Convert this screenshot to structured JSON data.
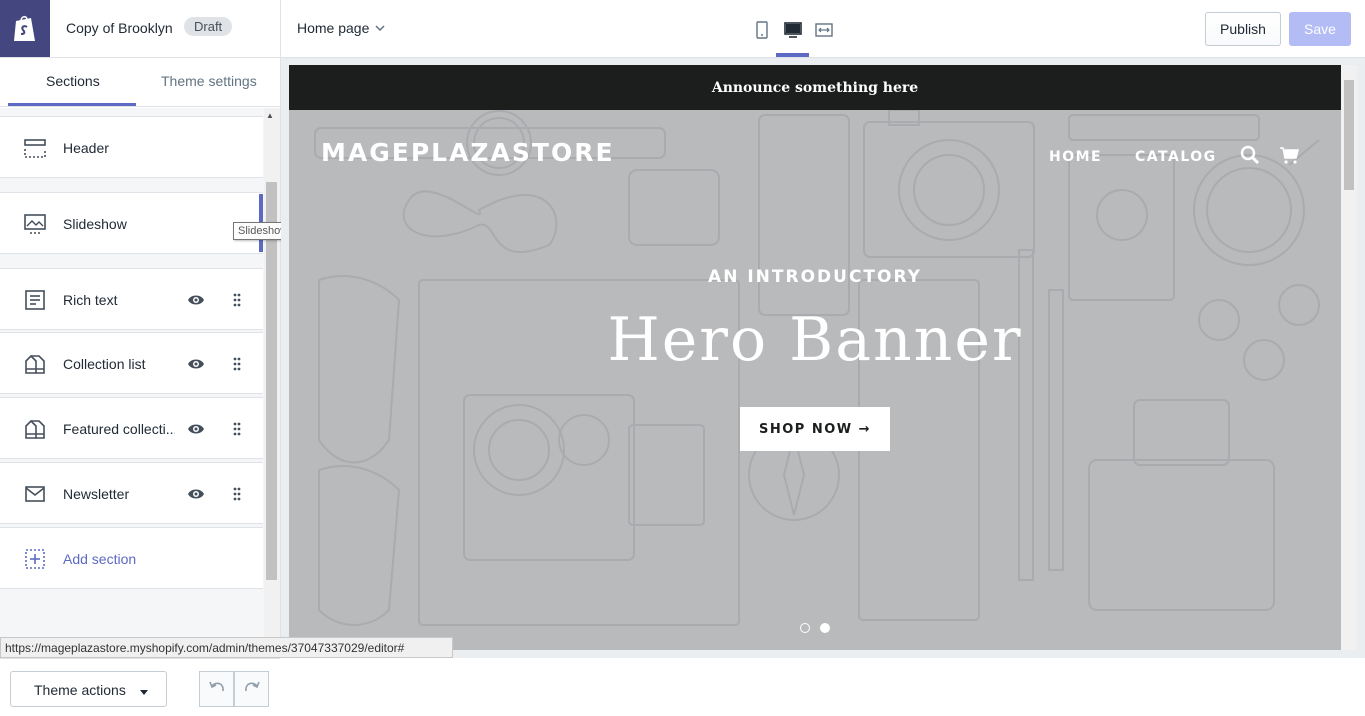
{
  "topbar": {
    "theme_name": "Copy of Brooklyn",
    "draft_badge": "Draft",
    "page_select": "Home page",
    "publish_label": "Publish",
    "save_label": "Save",
    "active_device": "desktop"
  },
  "sidebar": {
    "tabs": [
      {
        "label": "Sections",
        "active": true
      },
      {
        "label": "Theme settings",
        "active": false
      }
    ],
    "sections": [
      {
        "label": "Header",
        "icon": "header-icon"
      },
      {
        "label": "Slideshow",
        "icon": "slideshow-icon",
        "active": true
      },
      {
        "label": "Rich text",
        "icon": "rich-text-icon"
      },
      {
        "label": "Collection list",
        "icon": "collection-icon"
      },
      {
        "label": "Featured collecti...",
        "icon": "collection-icon"
      },
      {
        "label": "Newsletter",
        "icon": "mail-icon"
      }
    ],
    "add_section_label": "Add section",
    "tooltip": "Slideshow",
    "theme_actions_label": "Theme actions"
  },
  "status_url": "https://mageplazastore.myshopify.com/admin/themes/37047337029/editor#",
  "preview": {
    "announcement": "Announce something here",
    "store_name": "MAGEPLAZASTORE",
    "nav": [
      "HOME",
      "CATALOG"
    ],
    "intro": "AN INTRODUCTORY",
    "hero_title": "Hero Banner",
    "cta": "SHOP NOW",
    "slides_total": 2,
    "current_slide": 2
  },
  "colors": {
    "accent": "#5c6ac4",
    "logo_bg": "#43467f",
    "announce_bg": "#1c1d1d",
    "hero_bg": "#b9babc",
    "save_disabled": "#b3bcf5"
  }
}
